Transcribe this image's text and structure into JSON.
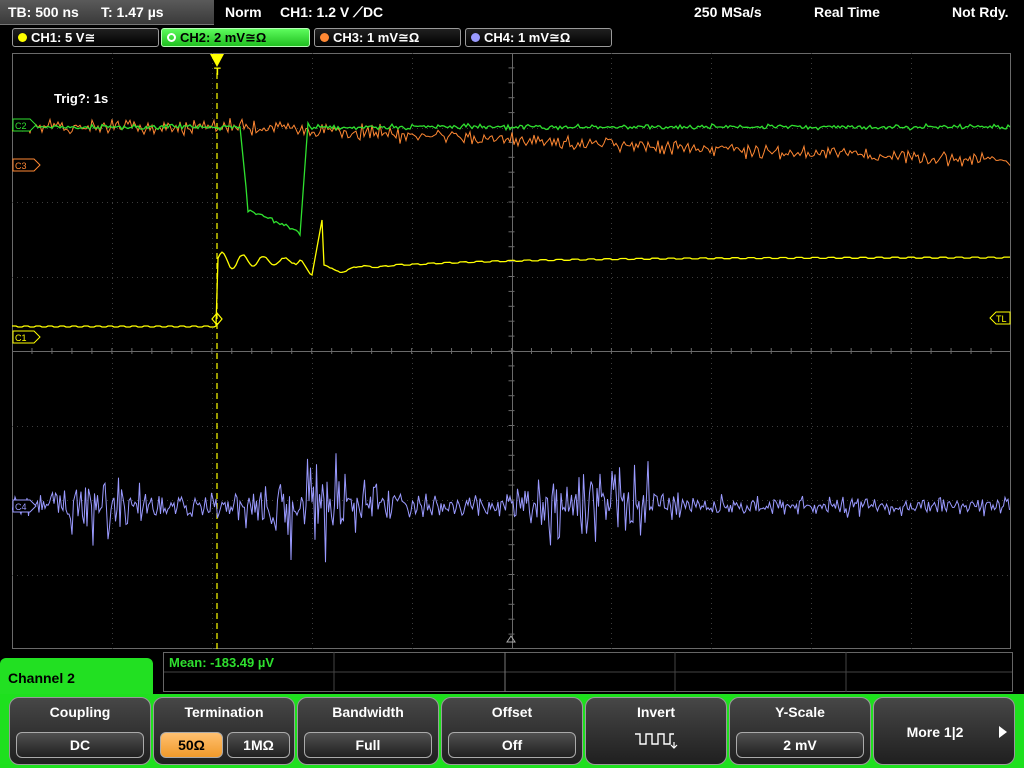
{
  "status": {
    "timebase": "TB: 500 ns",
    "trigger_time": "T: 1.47 µs",
    "mode": "Norm",
    "trigger_setting": "CH1: 1.2 V ⟋DC",
    "sample_rate": "250 MSa/s",
    "acq_mode": "Real Time",
    "ready_state": "Not Rdy."
  },
  "channels": [
    {
      "label": "CH1: 5 V≅",
      "color": "#ffff00"
    },
    {
      "label": "CH2: 2 mV≅Ω",
      "color": "#2fe02f"
    },
    {
      "label": "CH3: 1 mV≅Ω",
      "color": "#ff8833"
    },
    {
      "label": "CH4: 1 mV≅Ω",
      "color": "#9a9aff"
    }
  ],
  "grid": {
    "trig_info": "Trig?: 1s",
    "markers": {
      "c2": "C2",
      "c3": "C3",
      "c1": "C1",
      "c4": "C4",
      "tl": "TL"
    }
  },
  "measurement": "Mean: -183.49 µV",
  "active_channel": "Channel 2",
  "softkeys": {
    "coupling": {
      "title": "Coupling",
      "value": "DC"
    },
    "termination": {
      "title": "Termination",
      "opt1": "50Ω",
      "opt2": "1MΩ"
    },
    "bandwidth": {
      "title": "Bandwidth",
      "value": "Full"
    },
    "offset": {
      "title": "Offset",
      "value": "Off"
    },
    "invert": {
      "title": "Invert"
    },
    "yscale": {
      "title": "Y-Scale",
      "value": "2 mV"
    },
    "more": {
      "label": "More 1|2"
    }
  }
}
